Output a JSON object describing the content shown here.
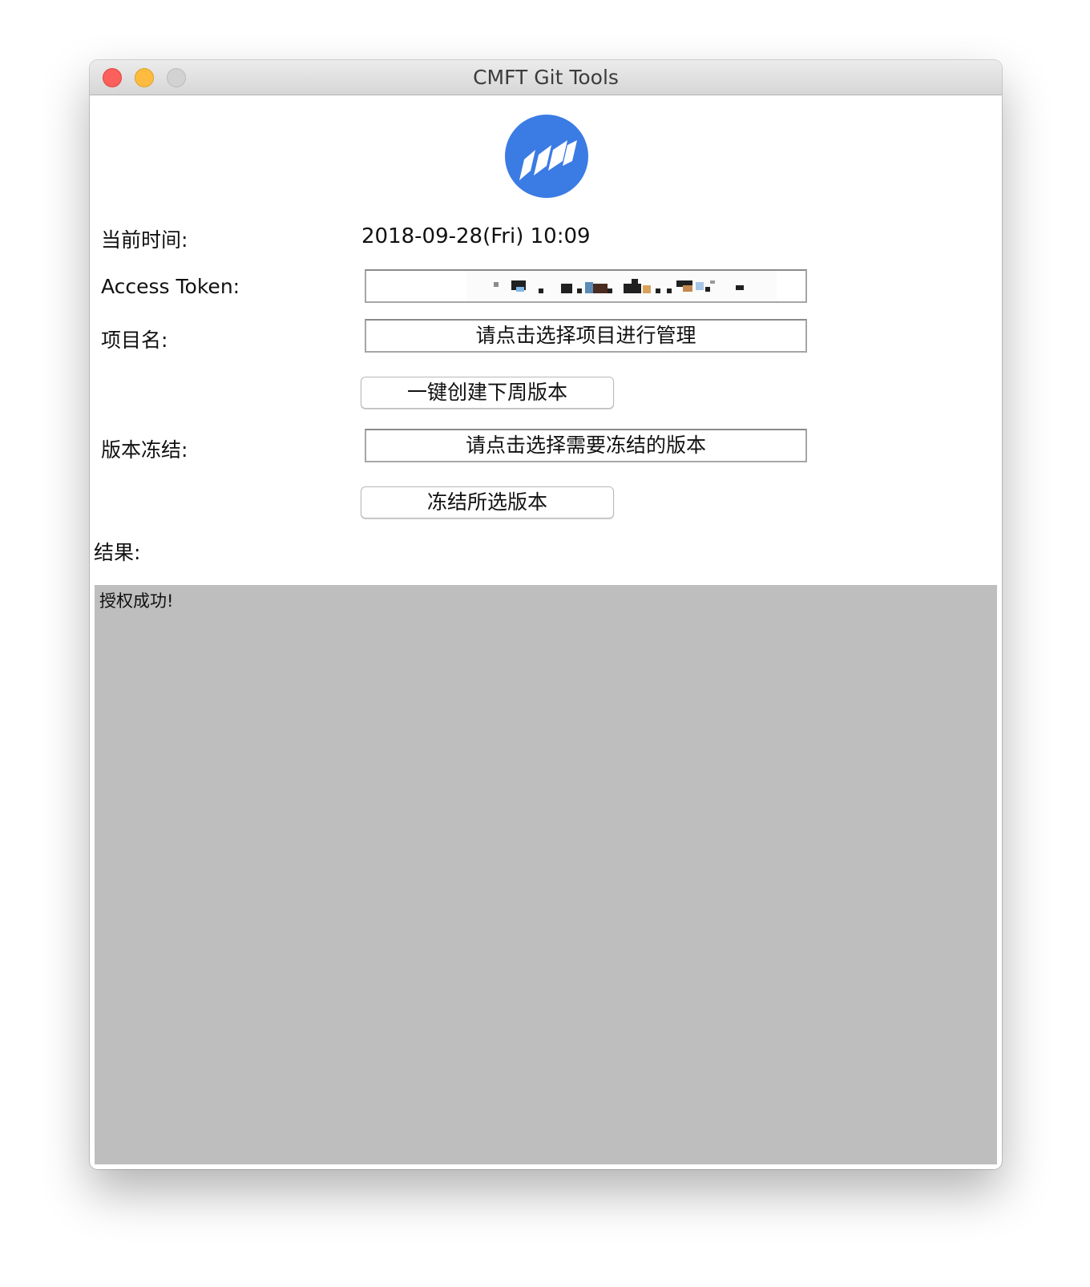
{
  "window": {
    "title": "CMFT Git Tools"
  },
  "logo": {
    "icon": "cmft-logo-icon",
    "color": "#3b7be4"
  },
  "form": {
    "time_label": "当前时间:",
    "time_value": "2018-09-28(Fri) 10:09",
    "token_label": "Access Token:",
    "project_label": "项目名:",
    "project_select": "请点击选择项目进行管理",
    "create_button": "一键创建下周版本",
    "freeze_label": "版本冻结:",
    "freeze_select": "请点击选择需要冻结的版本",
    "freeze_button": "冻结所选版本",
    "result_label": "结果:",
    "result_text": "授权成功!"
  },
  "colors": {
    "close": "#fc605c",
    "minimize": "#fdbc40",
    "zoom": "#d2d2d2",
    "result_bg": "#bebebe"
  }
}
